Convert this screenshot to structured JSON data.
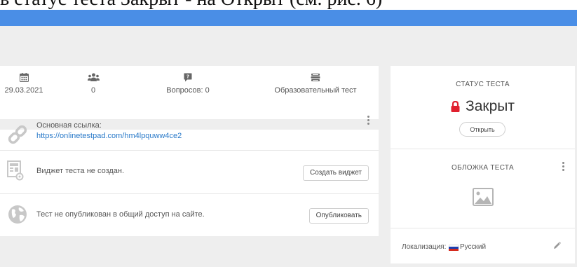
{
  "caption": "в статус теста Закрыт - на Открыт (см. рис. 6)",
  "stats": {
    "date": "29.03.2021",
    "users": "0",
    "questions": "Вопросов: 0",
    "type": "Образовательный тест"
  },
  "links": {
    "main_link_label": "Основная ссылка:",
    "main_link_url": "https://onlinetestpad.com/hm4lpquww4ce2",
    "widget_text": "Виджет теста не создан.",
    "widget_button": "Создать виджет",
    "publish_text": "Тест не опубликован в общий доступ на сайте.",
    "publish_button": "Опубликовать"
  },
  "status": {
    "label": "СТАТУС ТЕСТА",
    "value": "Закрыт",
    "open_button": "Открыть"
  },
  "cover": {
    "label": "ОБЛОЖКА ТЕСТА"
  },
  "locale": {
    "label": "Локализация:",
    "value": "Русский"
  },
  "icons": {
    "calendar": "calendar-icon",
    "users": "users-icon",
    "question": "question-icon",
    "book": "book-icon",
    "link": "link-icon",
    "widget": "widget-icon",
    "globe": "globe-icon",
    "lock": "lock-icon",
    "image": "image-icon",
    "pencil": "pencil-icon",
    "kebab": "kebab-icon"
  },
  "colors": {
    "accent": "#4a8ee6",
    "link": "#2a7ac9",
    "lock": "#e0202e",
    "background": "#eeeeee"
  }
}
